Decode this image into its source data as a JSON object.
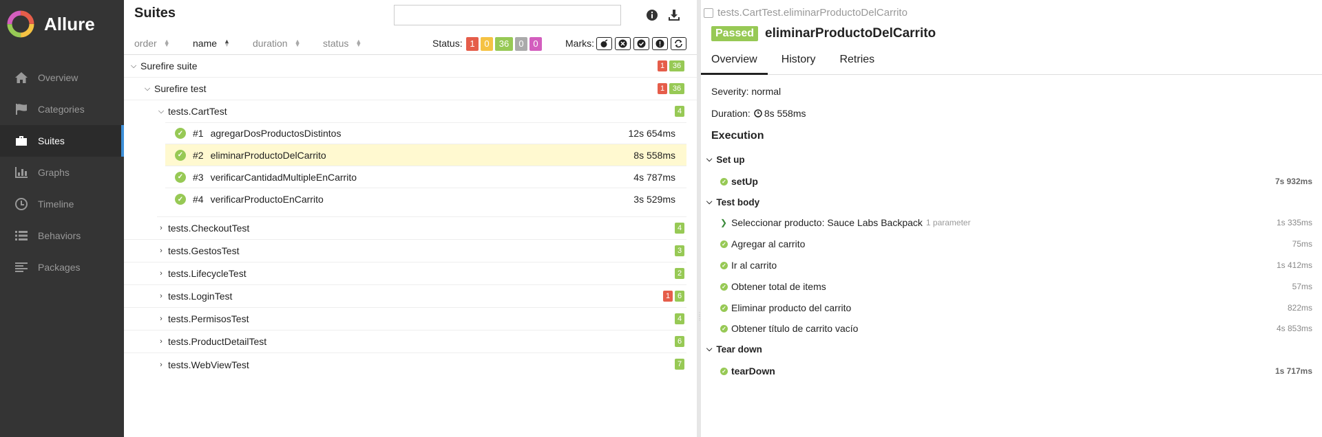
{
  "sidebar": {
    "brand": "Allure",
    "items": [
      {
        "label": "Overview",
        "icon": "home-icon"
      },
      {
        "label": "Categories",
        "icon": "flag-icon"
      },
      {
        "label": "Suites",
        "icon": "briefcase-icon"
      },
      {
        "label": "Graphs",
        "icon": "bar-chart-icon"
      },
      {
        "label": "Timeline",
        "icon": "clock-icon"
      },
      {
        "label": "Behaviors",
        "icon": "list-icon"
      },
      {
        "label": "Packages",
        "icon": "align-left-icon"
      }
    ],
    "active": "Suites"
  },
  "suites": {
    "title": "Suites",
    "search_value": "",
    "sort": {
      "order": "order",
      "name": "name",
      "duration": "duration",
      "status": "status"
    },
    "status_label": "Status:",
    "status_counts": {
      "failed": "1",
      "broken": "0",
      "passed": "36",
      "skipped": "0",
      "unknown": "0"
    },
    "marks_label": "Marks:",
    "tree": {
      "root": {
        "label": "Surefire suite",
        "failed": "1",
        "passed": "36"
      },
      "child": {
        "label": "Surefire test",
        "failed": "1",
        "passed": "36"
      },
      "open_class": {
        "label": "tests.CartTest",
        "passed": "4"
      },
      "tests": [
        {
          "num": "#1",
          "name": "agregarDosProductosDistintos",
          "duration": "12s 654ms"
        },
        {
          "num": "#2",
          "name": "eliminarProductoDelCarrito",
          "duration": "8s 558ms"
        },
        {
          "num": "#3",
          "name": "verificarCantidadMultipleEnCarrito",
          "duration": "4s 787ms"
        },
        {
          "num": "#4",
          "name": "verificarProductoEnCarrito",
          "duration": "3s 529ms"
        }
      ],
      "classes": [
        {
          "label": "tests.CheckoutTest",
          "passed": "4"
        },
        {
          "label": "tests.GestosTest",
          "passed": "3"
        },
        {
          "label": "tests.LifecycleTest",
          "passed": "2"
        },
        {
          "label": "tests.LoginTest",
          "failed": "1",
          "passed": "6"
        },
        {
          "label": "tests.PermisosTest",
          "passed": "4"
        },
        {
          "label": "tests.ProductDetailTest",
          "passed": "6"
        },
        {
          "label": "tests.WebViewTest",
          "passed": "7"
        }
      ]
    }
  },
  "detail": {
    "breadcrumb": "tests.CartTest.eliminarProductoDelCarrito",
    "status": "Passed",
    "name": "eliminarProductoDelCarrito",
    "tabs": [
      "Overview",
      "History",
      "Retries"
    ],
    "severity": "Severity: normal",
    "duration_label": "Duration:",
    "duration": "8s 558ms",
    "execution": "Execution",
    "setup_label": "Set up",
    "setup_step": {
      "name": "setUp",
      "duration": "7s 932ms"
    },
    "body_label": "Test body",
    "steps": [
      {
        "name": "Seleccionar producto: Sauce Labs Backpack",
        "param": "1 parameter",
        "duration": "1s 335ms"
      },
      {
        "name": "Agregar al carrito",
        "duration": "75ms"
      },
      {
        "name": "Ir al carrito",
        "duration": "1s 412ms"
      },
      {
        "name": "Obtener total de items",
        "duration": "57ms"
      },
      {
        "name": "Eliminar producto del carrito",
        "duration": "822ms"
      },
      {
        "name": "Obtener título de carrito vacío",
        "duration": "4s 853ms"
      }
    ],
    "teardown_label": "Tear down",
    "teardown_step": {
      "name": "tearDown",
      "duration": "1s 717ms"
    }
  },
  "colors": {
    "passed": "#97c955",
    "failed": "#e55d4a",
    "broken": "#f5c243",
    "skipped": "#aaaaaa",
    "unknown": "#d35ebe",
    "sidebar": "#343434"
  }
}
